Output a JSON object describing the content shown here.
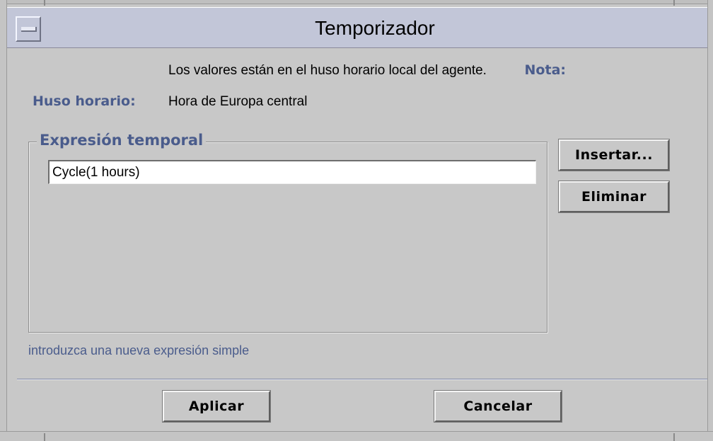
{
  "window": {
    "title": "Temporizador"
  },
  "info": {
    "note_label": "Nota:",
    "note_value": "Los valores están en el huso horario local del agente.",
    "timezone_label": "Huso horario:",
    "timezone_value": "Hora de Europa central"
  },
  "expression_group": {
    "title": "Expresión temporal",
    "input_value": "Cycle(1 hours)"
  },
  "side_buttons": {
    "insert_label": "Insertar...",
    "delete_label": "Eliminar"
  },
  "status": {
    "hint": "introduzca una nueva expresión simple"
  },
  "footer": {
    "apply_label": "Aplicar",
    "cancel_label": "Cancelar"
  },
  "colors": {
    "titlebar": "#c2c6d8",
    "label_accent": "#4a5c8c",
    "background": "#c8c8c8"
  }
}
